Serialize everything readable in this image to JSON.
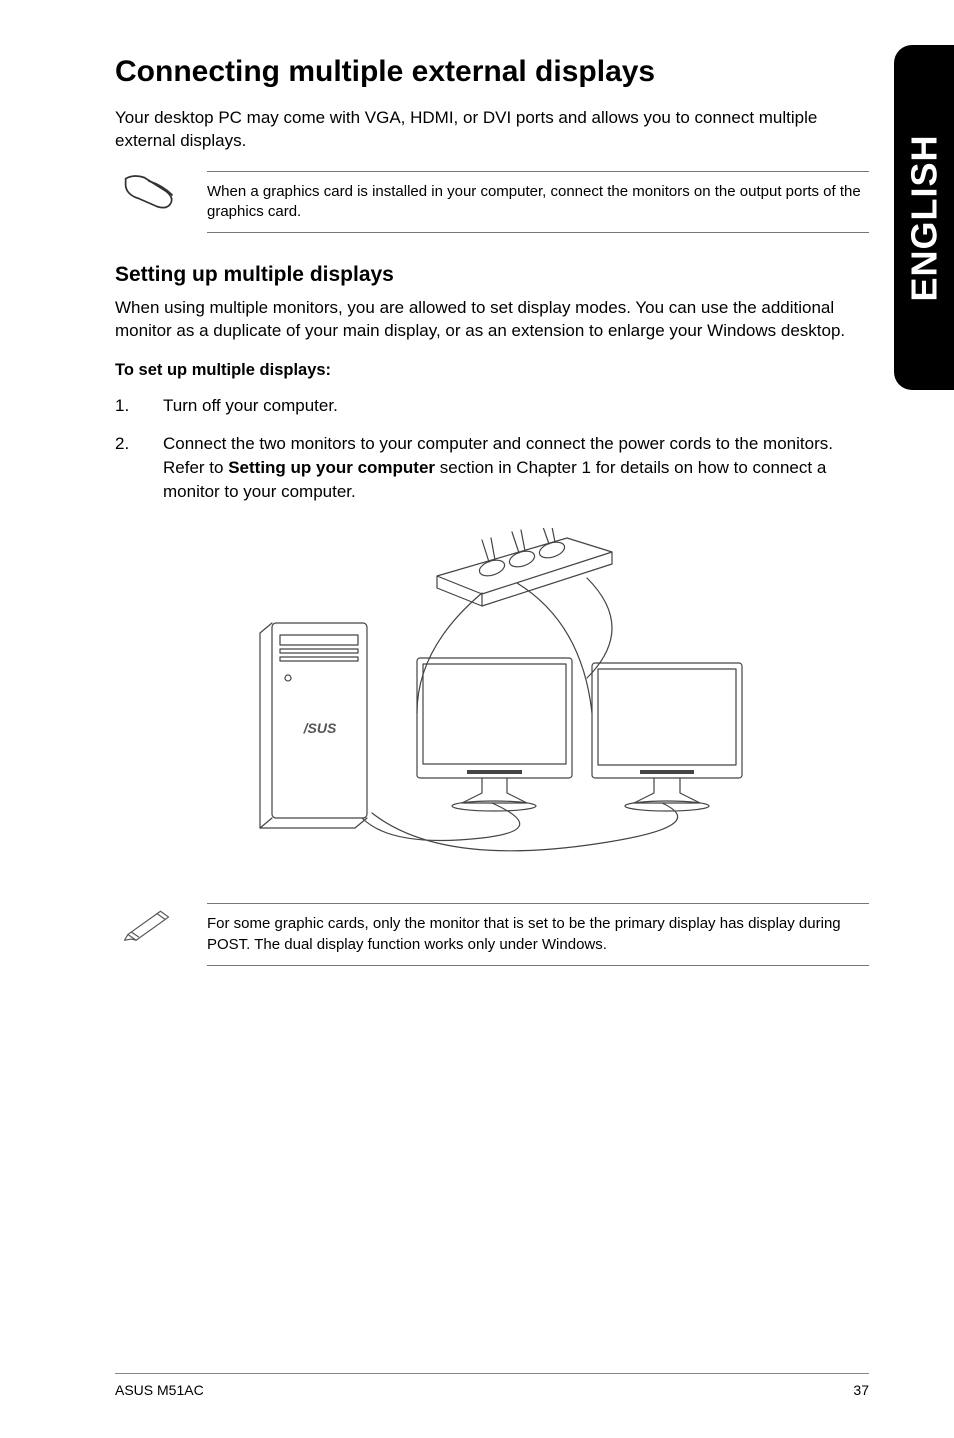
{
  "sideTab": "ENGLISH",
  "heading": "Connecting multiple external displays",
  "intro": "Your desktop PC may come with VGA, HDMI, or DVI ports and allows you to connect multiple external displays.",
  "note1": "When a graphics card is installed in your computer, connect the monitors on the output ports of the graphics card.",
  "subheading": "Setting up multiple displays",
  "subBody": "When using multiple monitors, you are allowed to set display modes. You can use the additional monitor as a duplicate of your main display, or as an extension to enlarge your Windows desktop.",
  "stepsHeading": "To set up multiple displays:",
  "steps": [
    {
      "num": "1.",
      "text": "Turn off your computer."
    },
    {
      "num": "2.",
      "textPre": "Connect the two monitors to your computer and connect the power cords to the monitors. Refer to ",
      "bold": "Setting up your computer",
      "textPost": " section in Chapter 1 for details on how to connect a monitor to your computer."
    }
  ],
  "note2": "For some graphic cards, only the monitor that is set to be the primary display has display during POST. The dual display function works only under Windows.",
  "footerLeft": "ASUS M51AC",
  "footerRight": "37"
}
